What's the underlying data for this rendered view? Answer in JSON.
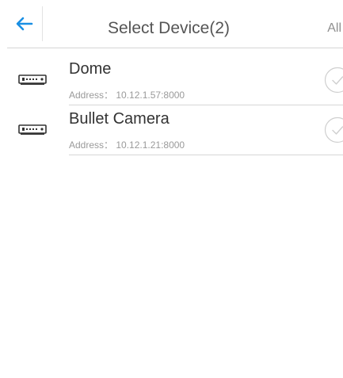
{
  "header": {
    "title": "Select Device(2)",
    "all_label": "All",
    "back_icon": "back-arrow-icon",
    "accent_color": "#1a8fe3"
  },
  "devices": [
    {
      "name": "Dome",
      "address": "Address： 10.12.1.57:8000",
      "icon": "dvr-device-icon",
      "selected": false
    },
    {
      "name": "Bullet Camera",
      "address": "Address： 10.12.1.21:8000",
      "icon": "dvr-device-icon",
      "selected": false
    }
  ]
}
